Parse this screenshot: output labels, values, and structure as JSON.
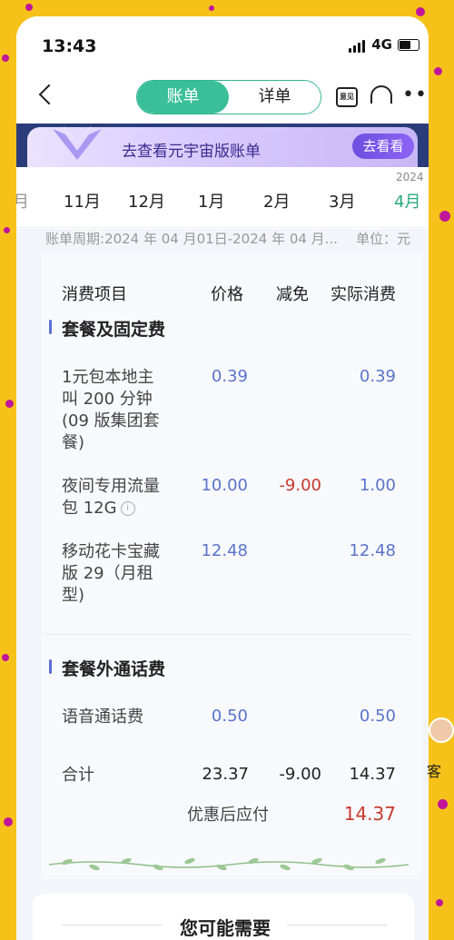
{
  "status": {
    "time": "13:43",
    "network": "4G"
  },
  "nav": {
    "tab_active": "账单",
    "tab_inactive": "详单",
    "feedback_icon_label": "意见"
  },
  "banner": {
    "text": "去查看元宇宙版账单",
    "button": "去看看"
  },
  "months": {
    "year": "2024",
    "items": [
      "月",
      "11月",
      "12月",
      "1月",
      "2月",
      "3月",
      "4月"
    ],
    "active": "4月"
  },
  "bill": {
    "period": "账单周期:2024 年 04 月01日-2024 年 04 月...",
    "unit": "单位：元",
    "headers": {
      "item": "消费项目",
      "price": "价格",
      "discount": "减免",
      "actual": "实际消费"
    },
    "section1": {
      "title": "套餐及固定费",
      "rows": [
        {
          "name": "1元包本地主叫 200 分钟 (09 版集团套餐)",
          "price": "0.39",
          "discount": "",
          "actual": "0.39"
        },
        {
          "name": "夜间专用流量包 12G",
          "price": "10.00",
          "discount": "-9.00",
          "actual": "1.00"
        },
        {
          "name": "移动花卡宝藏版 29（月租型)",
          "price": "12.48",
          "discount": "",
          "actual": "12.48"
        }
      ]
    },
    "section2": {
      "title": "套餐外通话费",
      "rows": [
        {
          "name": "语音通话费",
          "price": "0.50",
          "discount": "",
          "actual": "0.50"
        }
      ]
    },
    "total": {
      "label": "合计",
      "price": "23.37",
      "discount": "-9.00",
      "actual": "14.37"
    },
    "payable": {
      "label": "优惠后应付",
      "value": "14.37"
    }
  },
  "bottom": {
    "title": "您可能需要"
  },
  "side": {
    "kefu": "客"
  },
  "colors": {
    "accent": "#3bbf98",
    "background": "#f6c21a",
    "discount": "#c8382c",
    "value": "#5a74c9"
  }
}
